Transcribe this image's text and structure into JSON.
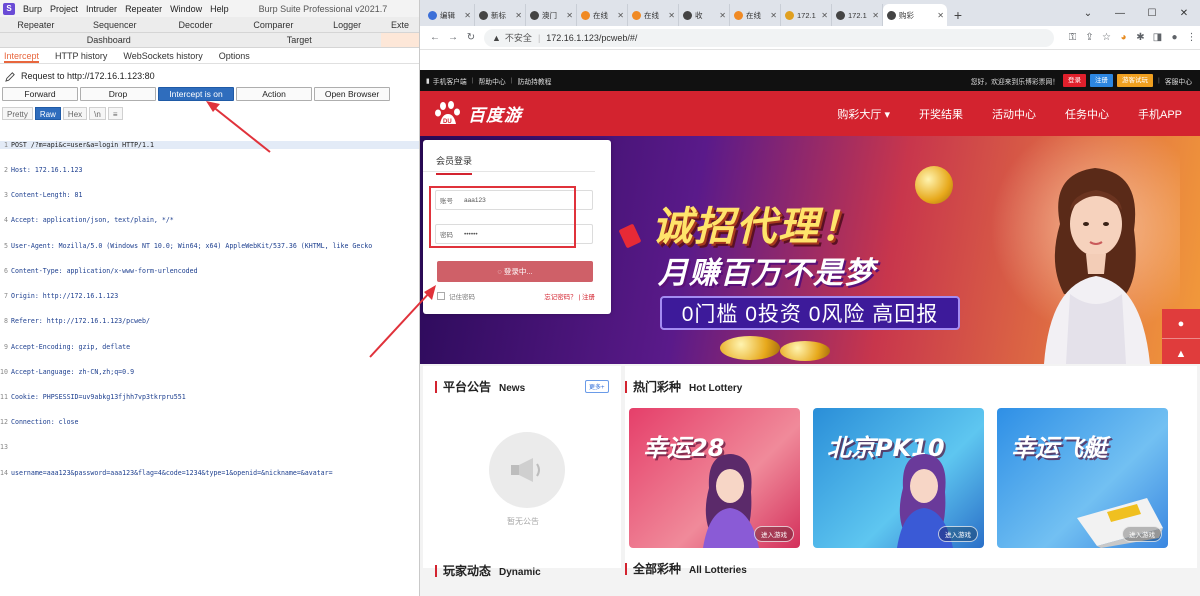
{
  "burp": {
    "menu": [
      "Burp",
      "Project",
      "Intruder",
      "Repeater",
      "Window",
      "Help"
    ],
    "title": "Burp Suite Professional v2021.7",
    "tabs_row1": [
      "Repeater",
      "Sequencer",
      "Decoder",
      "Comparer",
      "Logger",
      "Exte"
    ],
    "tabs_row2": [
      "Dashboard",
      "Target"
    ],
    "subtabs": [
      "Intercept",
      "HTTP history",
      "WebSockets history",
      "Options"
    ],
    "request_to": "Request to http://172.16.1.123:80",
    "buttons": {
      "forward": "Forward",
      "drop": "Drop",
      "intercept": "Intercept is on",
      "action": "Action",
      "open_browser": "Open Browser"
    },
    "view_tabs": [
      "Pretty",
      "Raw",
      "Hex",
      "\\n",
      "≡"
    ],
    "request_lines": [
      {
        "n": "1",
        "text": "POST /?m=api&c=user&a=login HTTP/1.1"
      },
      {
        "n": "2",
        "text": "Host: 172.16.1.123"
      },
      {
        "n": "3",
        "text": "Content-Length: 81"
      },
      {
        "n": "4",
        "text": "Accept: application/json, text/plain, */*"
      },
      {
        "n": "5",
        "text": "User-Agent: Mozilla/5.0 (Windows NT 10.0; Win64; x64) AppleWebKit/537.36 (KHTML, like Gecko"
      },
      {
        "n": "6",
        "text": "Content-Type: application/x-www-form-urlencoded"
      },
      {
        "n": "7",
        "text": "Origin: http://172.16.1.123"
      },
      {
        "n": "8",
        "text": "Referer: http://172.16.1.123/pcweb/"
      },
      {
        "n": "9",
        "text": "Accept-Encoding: gzip, deflate"
      },
      {
        "n": "10",
        "text": "Accept-Language: zh-CN,zh;q=0.9"
      },
      {
        "n": "11",
        "text": "Cookie: PHPSESSID=uv9abkg13fjhh7vp3tkrpru551"
      },
      {
        "n": "12",
        "text": "Connection: close"
      },
      {
        "n": "13",
        "text": ""
      },
      {
        "n": "14",
        "text": "username=aaa123&password=aaa123&flag=4&code=1234&type=1&openid=&nickname=&avatar="
      }
    ]
  },
  "chrome": {
    "tabs": [
      {
        "label": "编辑",
        "color": "#3b6fd8"
      },
      {
        "label": "新标",
        "color": "#444444"
      },
      {
        "label": "澳门",
        "color": "#444444"
      },
      {
        "label": "在线",
        "color": "#f08a24"
      },
      {
        "label": "在线",
        "color": "#f08a24"
      },
      {
        "label": "收",
        "color": "#444444"
      },
      {
        "label": "在线",
        "color": "#f08a24"
      },
      {
        "label": "172.1",
        "color": "#e0a020"
      },
      {
        "label": "172.1",
        "color": "#444444"
      }
    ],
    "active_tab": {
      "label": "购彩",
      "color": "#444444"
    },
    "insecure": "不安全",
    "url": "172.16.1.123/pcweb/#/"
  },
  "site": {
    "topbar": {
      "mobile": "手机客户端",
      "help": "帮助中心",
      "fraud": "防劫持教程",
      "welcome": "您好，欢迎来到乐博彩票网！",
      "login": "登录",
      "register": "注册",
      "trial": "游客试玩",
      "service": "客服中心"
    },
    "logo": "百度游",
    "nav": [
      "购彩大厅 ▾",
      "开奖结果",
      "活动中心",
      "任务中心",
      "手机APP"
    ],
    "banner": {
      "title1": "诚招代理！",
      "title2": "月赚百万不是梦",
      "pill": "0门槛 0投资 0风险 高回报"
    },
    "login": {
      "title": "会员登录",
      "account_label": "账号",
      "account_value": "aaa123",
      "password_label": "密码",
      "password_value": "••••••",
      "button": "◌ 登录中...",
      "remember": "记住密码",
      "forgot": "忘记密码？",
      "register": "| 注册"
    },
    "notice": {
      "title": "平台公告",
      "en": "News",
      "more": "更多+",
      "empty": "暂无公告"
    },
    "hot": {
      "title": "热门彩种",
      "en": "Hot Lottery"
    },
    "games": [
      {
        "name": "幸运28",
        "enter": "进入游戏"
      },
      {
        "name": "北京PK10",
        "enter": "进入游戏"
      },
      {
        "name": "幸运飞艇",
        "enter": "进入游戏"
      }
    ],
    "dynamic": {
      "title": "玩家动态",
      "en": "Dynamic"
    },
    "all": {
      "title": "全部彩种",
      "en": "All Lotteries"
    }
  }
}
